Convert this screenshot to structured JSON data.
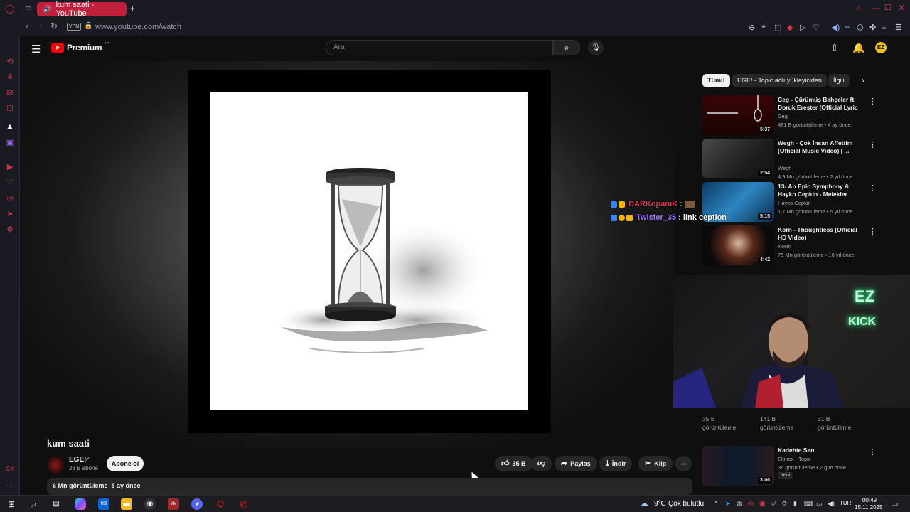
{
  "browser": {
    "tab_title": "kum saati - YouTube",
    "url": "www.youtube.com/watch",
    "vpn_label": "VPN",
    "accent": "#c11f3c"
  },
  "youtube": {
    "logo_text": "Premium",
    "region": "TR",
    "search_placeholder": "Ara"
  },
  "video": {
    "title": "kum saati",
    "channel": "EGE!",
    "subscribers": "28 B abone",
    "subscribe_label": "Abone ol",
    "likes": "35 B",
    "share_label": "Paylaş",
    "download_label": "İndir",
    "clip_label": "Klip",
    "views": "6 Mn görüntüleme",
    "age": "5 ay önce"
  },
  "sidebar": {
    "chips": [
      "Tümü",
      "EGE! - Topic adlı yükleyiciden",
      "İlgili"
    ],
    "recommendations": [
      {
        "title": "Ceg - Çürümüş Bahçeler ft. Doruk Ereşter (Official Lyric ...",
        "channel": "Ceg",
        "meta": "481 B görüntüleme • 4 ay önce",
        "duration": "5:37"
      },
      {
        "title": "Wegh - Çok İnsan Affettim (Official Music Video) | ...",
        "channel": "Wegh",
        "meta": "4,9 Mn görüntüleme • 2 yıl önce",
        "duration": "2:54"
      },
      {
        "title": "13- An Epic Symphony & Hayko Cepkin - Melekler",
        "channel": "Hayko Cepkin",
        "meta": "1,7 Mn görüntüleme • 5 yıl önce",
        "duration": "5:15"
      },
      {
        "title": "Korn - Thoughtless (Official HD Video)",
        "channel": "KoRn",
        "meta": "75 Mn görüntüleme • 16 yıl önce",
        "duration": "4:42"
      }
    ],
    "shelf_stats": [
      "35 B",
      "141 B",
      "31 B"
    ],
    "shelf_unit": "görüntüleme",
    "last_rec": {
      "title": "Kadehte Sen",
      "channel": "Ekinox - Topic",
      "meta": "36 görüntüleme • 2 gün önce",
      "badge": "Yeni",
      "duration": "3:00"
    }
  },
  "chat": [
    {
      "user": "DARKopaniK",
      "user_color": "#e0335a",
      "message": ""
    },
    {
      "user": "Twister_35",
      "user_color": "#a970ff",
      "message": "link ception"
    }
  ],
  "webcam": {
    "neon_line1": "EZ",
    "neon_line2": "KICK"
  },
  "taskbar": {
    "temperature": "9°C",
    "condition": "Çok bulutlu",
    "lang": "TUR",
    "time": "00:49",
    "date": "15.11.2025"
  }
}
